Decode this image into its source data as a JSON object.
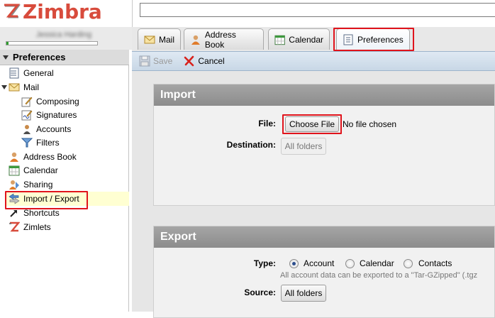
{
  "app": {
    "logo_text": "Zimbra"
  },
  "user": {
    "name": "Jessica Harding",
    "quota_fraction": 0.02
  },
  "sidebar": {
    "header": "Preferences",
    "items": [
      {
        "label": "General"
      },
      {
        "label": "Mail"
      },
      {
        "label": "Composing"
      },
      {
        "label": "Signatures"
      },
      {
        "label": "Accounts"
      },
      {
        "label": "Filters"
      },
      {
        "label": "Address Book"
      },
      {
        "label": "Calendar"
      },
      {
        "label": "Sharing"
      },
      {
        "label": "Import / Export"
      },
      {
        "label": "Shortcuts"
      },
      {
        "label": "Zimlets"
      }
    ],
    "selected": "Import / Export"
  },
  "tabs": [
    {
      "label": "Mail"
    },
    {
      "label": "Address Book"
    },
    {
      "label": "Calendar"
    },
    {
      "label": "Preferences"
    }
  ],
  "toolbar": {
    "save_label": "Save",
    "cancel_label": "Cancel"
  },
  "import": {
    "title": "Import",
    "file_label": "File:",
    "choose_file_label": "Choose File",
    "no_file_text": "No file chosen",
    "destination_label": "Destination:",
    "destination_value": "All folders"
  },
  "export": {
    "title": "Export",
    "type_label": "Type:",
    "options": [
      "Account",
      "Calendar",
      "Contacts"
    ],
    "selected_option": "Account",
    "note": "All account data can be exported to a \"Tar-GZipped\" (.tgz",
    "source_label": "Source:",
    "source_value": "All folders"
  },
  "colors": {
    "brand": "#d84b3c",
    "highlight": "#e0141c",
    "selection": "#ffffd2"
  }
}
